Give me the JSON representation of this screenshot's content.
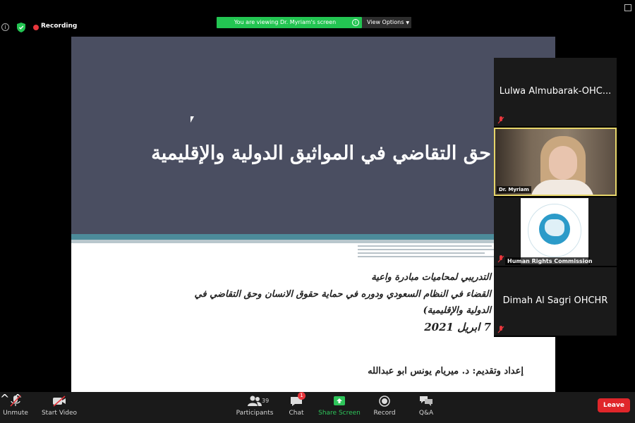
{
  "topbar": {
    "recording_label": "Recording",
    "viewing_banner": "You are viewing Dr. Myriam's screen",
    "view_options_label": "View Options",
    "colors": {
      "banner": "#23c552",
      "record_dot": "#e8363c"
    }
  },
  "slide": {
    "title": "حق التقاضي في المواثيق الدولية والإقليمية",
    "subtitle_lines": [
      "التدريبي لمحاميات مبادرة واعية",
      "القضاء في النظام السعودي ودوره في حماية حقوق الانسان وحق التقاضي في",
      "الدولية والإقليمية)"
    ],
    "date": "7 ابريل 2021",
    "author": "إعداد وتقديم: د. ميريام يونس ابو عبدالله",
    "colors": {
      "header": "#4a4e61",
      "band": "#4c8b9a"
    }
  },
  "participants": [
    {
      "name": "Lulwa Almubarak-OHC...",
      "muted": true
    },
    {
      "name": "Dr. Myriam",
      "muted": false,
      "video": true
    },
    {
      "name": "Human Rights Commission",
      "muted": true,
      "logo": true
    },
    {
      "name": "Dimah Al Sagri OHCHR",
      "muted": true
    }
  ],
  "toolbar": {
    "unmute_label": "Unmute",
    "start_video_label": "Start Video",
    "participants_label": "Participants",
    "participants_count": "39",
    "chat_label": "Chat",
    "chat_badge": "1",
    "share_screen_label": "Share Screen",
    "record_label": "Record",
    "qa_label": "Q&A",
    "leave_label": "Leave",
    "colors": {
      "leave": "#e0262a",
      "share": "#2ec55a"
    }
  }
}
